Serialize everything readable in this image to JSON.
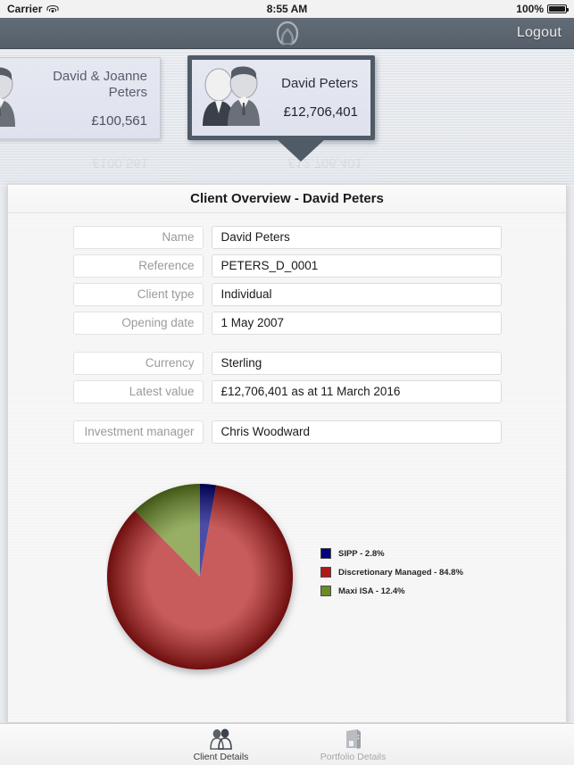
{
  "status_bar": {
    "carrier": "Carrier",
    "wifi_icon": "wifi-icon",
    "time": "8:55 AM",
    "battery_percent": "100%",
    "battery_icon": "battery-icon"
  },
  "navbar": {
    "logo_icon": "app-logo-m-icon",
    "logout_label": "Logout",
    "background_color": "#5b6570"
  },
  "carousel": {
    "cards": [
      {
        "name": "David & Joanne Peters",
        "value": "£100,561",
        "avatar_icon": "couple-avatar-icon",
        "selected": false
      },
      {
        "name": "David Peters",
        "value": "£12,706,401",
        "avatar_icon": "couple-avatar-icon",
        "selected": true
      }
    ],
    "selected_border_color": "#4f5b66"
  },
  "panel": {
    "title": "Client Overview - David Peters",
    "fields": [
      {
        "label": "Name",
        "value": "David Peters"
      },
      {
        "label": "Reference",
        "value": "PETERS_D_0001"
      },
      {
        "label": "Client type",
        "value": "Individual"
      },
      {
        "label": "Opening date",
        "value": "1 May 2007"
      },
      {
        "label": "Currency",
        "value": "Sterling"
      },
      {
        "label": "Latest value",
        "value": "£12,706,401 as at 11 March 2016"
      },
      {
        "label": "Investment manager",
        "value": "Chris Woodward"
      }
    ]
  },
  "chart_data": {
    "type": "pie",
    "title": "",
    "categories": [
      "SIPP",
      "Discretionary Managed",
      "Maxi ISA"
    ],
    "values": [
      2.8,
      84.8,
      12.4
    ],
    "colors": [
      "#000080",
      "#b11818",
      "#6b8c21"
    ],
    "legend_entries": [
      "SIPP - 2.8%",
      "Discretionary Managed - 84.8%",
      "Maxi ISA - 12.4%"
    ],
    "legend_position": "right",
    "start_angle_deg": 0,
    "direction": "clockwise",
    "units": "percent"
  },
  "tabbar": {
    "tabs": [
      {
        "label": "Client Details",
        "icon": "people-icon",
        "active": true
      },
      {
        "label": "Portfolio Details",
        "icon": "briefcase-icon",
        "active": false
      }
    ]
  }
}
